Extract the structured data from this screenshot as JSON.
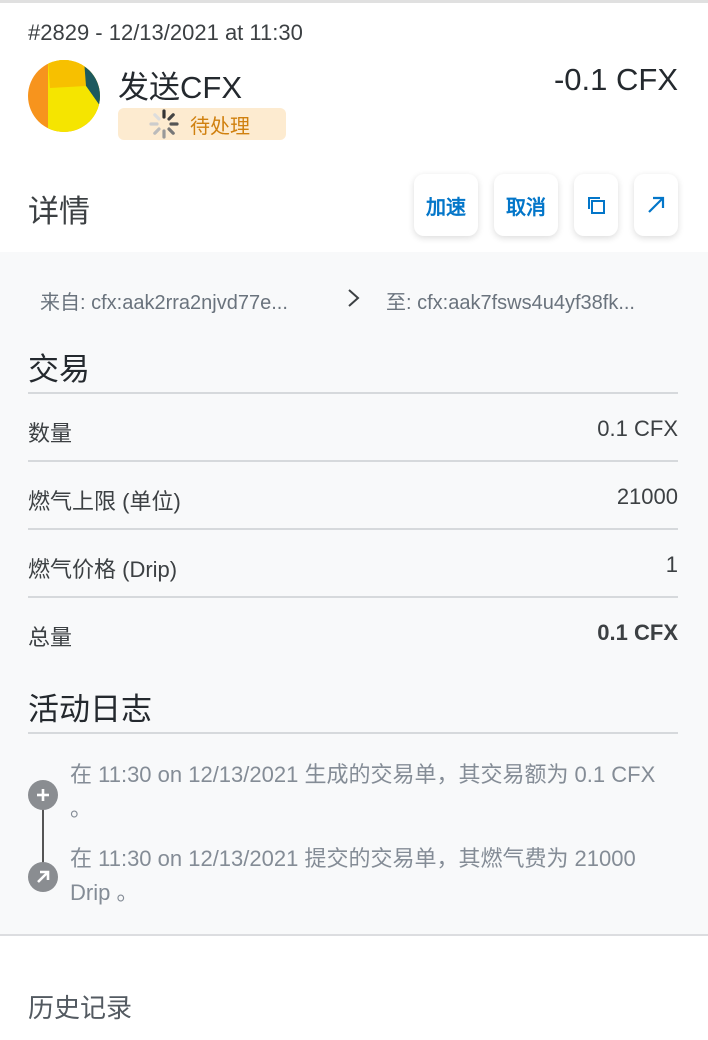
{
  "transaction": {
    "meta": "#2829 - 12/13/2021 at 11:30",
    "title": "发送CFX",
    "amount": "-0.1 CFX",
    "status_label": "待处理"
  },
  "details": {
    "title": "详情",
    "speed_up_label": "加速",
    "cancel_label": "取消",
    "copy_icon": "copy-icon",
    "open_icon": "external-link-icon"
  },
  "addresses": {
    "from": "来自: cfx:aak2rra2njvd77e...",
    "to": "至: cfx:aak7fsws4u4yf38fk..."
  },
  "trade": {
    "title": "交易",
    "rows": [
      {
        "label": "数量",
        "value": "0.1 CFX"
      },
      {
        "label": "燃气上限 (单位)",
        "value": "21000"
      },
      {
        "label": "燃气价格 (Drip)",
        "value": "1"
      },
      {
        "label": "总量",
        "value": "0.1 CFX"
      }
    ]
  },
  "activity": {
    "title": "活动日志",
    "entries": [
      {
        "icon": "plus-icon",
        "text": "在 11:30 on 12/13/2021 生成的交易单，其交易额为 0.1 CFX 。"
      },
      {
        "icon": "arrow-up-right-icon",
        "text": "在 11:30 on 12/13/2021 提交的交易单，其燃气费为 21000 Drip 。"
      }
    ]
  },
  "history": {
    "title": "历史记录"
  },
  "colors": {
    "accent": "#0376c9",
    "pending_bg": "#fdebd0",
    "pending_text": "#d0800f"
  }
}
